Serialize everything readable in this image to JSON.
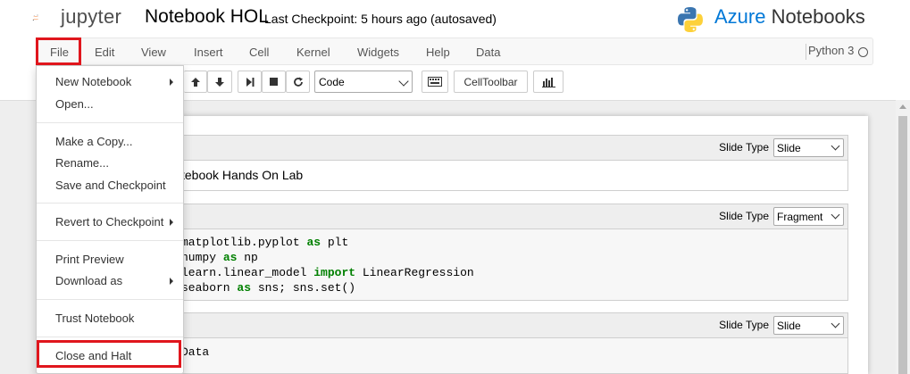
{
  "header": {
    "logo_text": "jupyter",
    "notebook_name": "Notebook HOL",
    "checkpoint": "Last Checkpoint: 5 hours ago (autosaved)",
    "brand_primary": "Azure",
    "brand_secondary": "Notebooks"
  },
  "menubar": {
    "items": [
      "File",
      "Edit",
      "View",
      "Insert",
      "Cell",
      "Kernel",
      "Widgets",
      "Help",
      "Data"
    ],
    "kernel": "Python 3"
  },
  "toolbar": {
    "cell_type": "Code",
    "celltoolbar_label": "CellToolbar"
  },
  "file_menu": {
    "items": [
      "New Notebook",
      "Open...",
      "Make a Copy...",
      "Rename...",
      "Save and Checkpoint",
      "Revert to Checkpoint",
      "Print Preview",
      "Download as",
      "Trust Notebook",
      "Close and Halt"
    ]
  },
  "cells": [
    {
      "slide_label": "Slide Type",
      "slide_type": "Slide",
      "text": "tebook Hands On Lab"
    },
    {
      "slide_label": "Slide Type",
      "slide_type": "Fragment"
    },
    {
      "slide_label": "Slide Type",
      "slide_type": "Slide",
      "text": "Data"
    }
  ],
  "code_lines": [
    [
      "matplotlib.pyplot ",
      "as",
      " plt"
    ],
    [
      "numpy ",
      "as",
      " np"
    ],
    [
      "learn.linear_model ",
      "import",
      " LinearRegression"
    ],
    [
      "seaborn ",
      "as",
      " sns; sns.set()"
    ]
  ],
  "colors": {
    "highlight": "#e0161d",
    "azure": "#0078d7",
    "keyword": "#008000",
    "jupyter_orange": "#f37626"
  }
}
